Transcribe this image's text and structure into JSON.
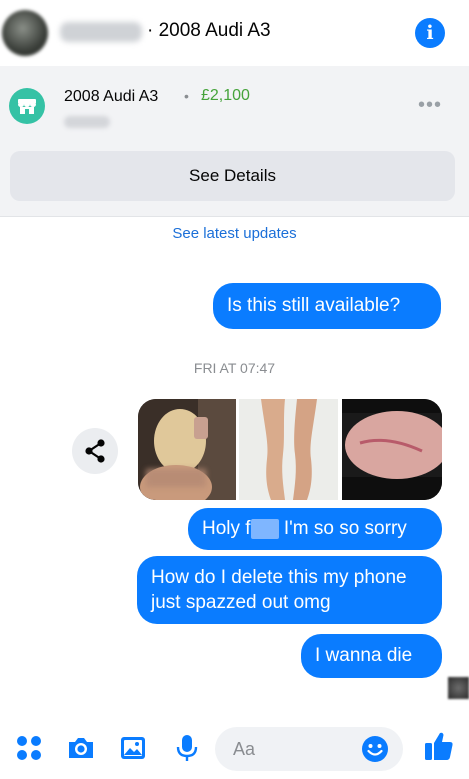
{
  "header": {
    "title": "· 2008 Audi A3",
    "info_icon": "info-icon",
    "info_glyph": "i"
  },
  "listing": {
    "title": "2008 Audi A3",
    "separator": "•",
    "price": "£2,100",
    "more_glyph": "•••",
    "see_details_label": "See Details",
    "accent_color": "#35c2a5",
    "price_color": "#45a33a"
  },
  "chat": {
    "see_latest_label": "See latest updates",
    "timestamp": "FRI AT 07:47",
    "messages": [
      {
        "text": "Is this still available?"
      },
      {
        "text_before": "Holy f",
        "text_after": " I'm so so sorry"
      },
      {
        "text": "How do I delete this my phone just spazzed out omg"
      },
      {
        "text": "I wanna die"
      }
    ],
    "bubble_color": "#0a7cff"
  },
  "composer": {
    "placeholder": "Aa",
    "icons": [
      "apps-icon",
      "camera-icon",
      "gallery-icon",
      "microphone-icon",
      "emoji-icon",
      "thumbs-up-icon"
    ],
    "accent_color": "#0a7cff"
  }
}
